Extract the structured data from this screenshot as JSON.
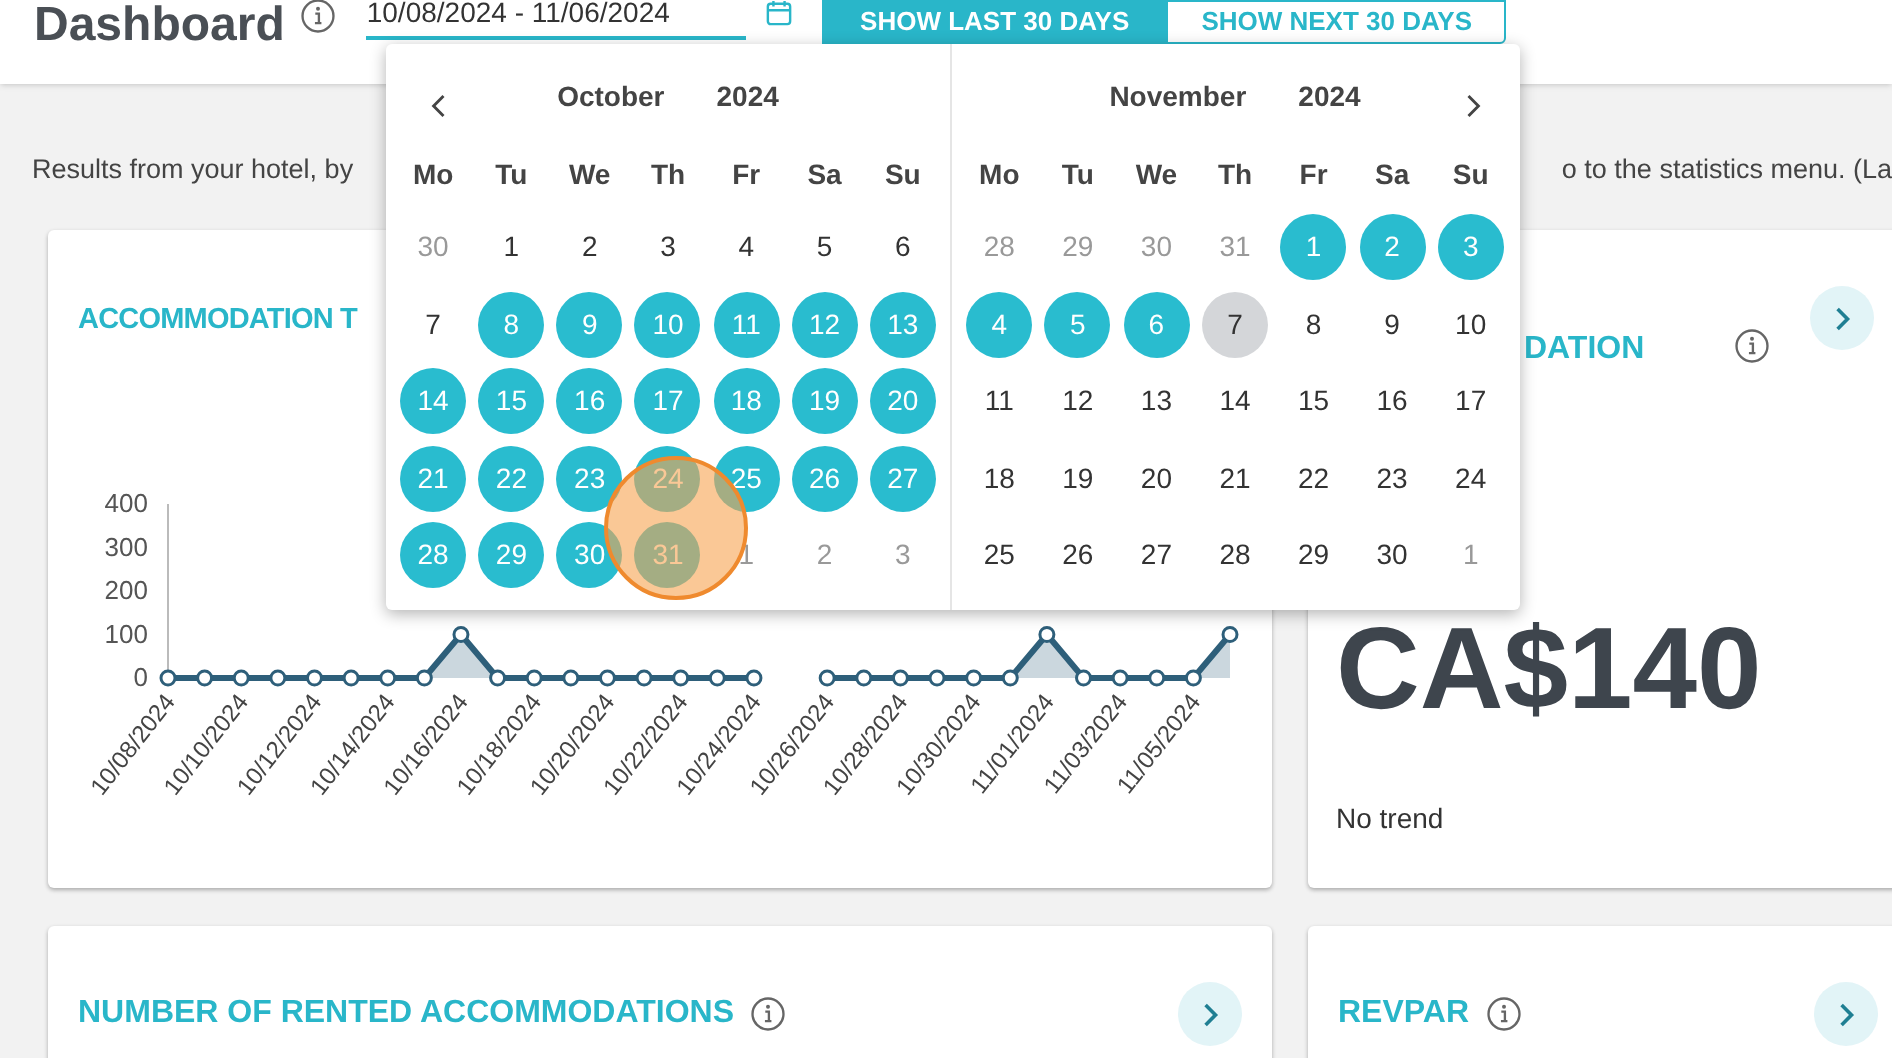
{
  "header": {
    "title": "Dashboard",
    "date_range": {
      "value": "10/08/2024 - 11/06/2024"
    },
    "buttons": [
      {
        "label": "SHOW LAST 30 DAYS",
        "selected": true
      },
      {
        "label": "SHOW NEXT 30 DAYS",
        "selected": false
      }
    ]
  },
  "intro": {
    "left": "Results from your hotel, by",
    "right": "o to the statistics menu. (La"
  },
  "cards": [
    {
      "kind": "chart",
      "title": "ACCOMMODATION T",
      "chart_data": {
        "type": "area",
        "categories": [
          "10/08/2024",
          null,
          "10/10/2024",
          null,
          "10/12/2024",
          null,
          "10/14/2024",
          null,
          "10/16/2024",
          null,
          "10/18/2024",
          null,
          "10/20/2024",
          null,
          "10/22/2024",
          null,
          "10/24/2024",
          null,
          "10/26/2024",
          null,
          "10/28/2024",
          null,
          "10/30/2024",
          null,
          "11/01/2024",
          null,
          "11/03/2024",
          null,
          "11/05/2024",
          null
        ],
        "series": [
          {
            "color": "#2e5f7a",
            "values": [
              0,
              0,
              0,
              0,
              0,
              0,
              0,
              0,
              100,
              0,
              0,
              0,
              0,
              0,
              0,
              0,
              0,
              null,
              0,
              0,
              0,
              0,
              0,
              0,
              100,
              0,
              0,
              0,
              0,
              100
            ]
          }
        ],
        "ylim": [
          0,
          400
        ],
        "yticks": [
          0,
          100,
          200,
          300,
          400
        ]
      }
    },
    {
      "kind": "value",
      "title": "DATION",
      "value": "CA$140",
      "trend": "No trend"
    },
    {
      "kind": "header",
      "title": "NUMBER OF RENTED ACCOMMODATIONS"
    },
    {
      "kind": "header",
      "title": "REVPAR"
    }
  ],
  "calendar": {
    "months": [
      {
        "month": "October",
        "year": "2024",
        "weekdays": [
          "Mo",
          "Tu",
          "We",
          "Th",
          "Fr",
          "Sa",
          "Su"
        ],
        "weeks": [
          [
            {
              "day": "30",
              "outside": true,
              "selected": false,
              "today": false
            },
            {
              "day": "1",
              "outside": false,
              "selected": false,
              "today": false
            },
            {
              "day": "2",
              "outside": false,
              "selected": false,
              "today": false
            },
            {
              "day": "3",
              "outside": false,
              "selected": false,
              "today": false
            },
            {
              "day": "4",
              "outside": false,
              "selected": false,
              "today": false
            },
            {
              "day": "5",
              "outside": false,
              "selected": false,
              "today": false
            },
            {
              "day": "6",
              "outside": false,
              "selected": false,
              "today": false
            }
          ],
          [
            {
              "day": "7",
              "outside": false,
              "selected": false,
              "today": false
            },
            {
              "day": "8",
              "outside": false,
              "selected": true,
              "today": false
            },
            {
              "day": "9",
              "outside": false,
              "selected": true,
              "today": false
            },
            {
              "day": "10",
              "outside": false,
              "selected": true,
              "today": false
            },
            {
              "day": "11",
              "outside": false,
              "selected": true,
              "today": false
            },
            {
              "day": "12",
              "outside": false,
              "selected": true,
              "today": false
            },
            {
              "day": "13",
              "outside": false,
              "selected": true,
              "today": false
            }
          ],
          [
            {
              "day": "14",
              "outside": false,
              "selected": true,
              "today": false
            },
            {
              "day": "15",
              "outside": false,
              "selected": true,
              "today": false
            },
            {
              "day": "16",
              "outside": false,
              "selected": true,
              "today": false
            },
            {
              "day": "17",
              "outside": false,
              "selected": true,
              "today": false
            },
            {
              "day": "18",
              "outside": false,
              "selected": true,
              "today": false
            },
            {
              "day": "19",
              "outside": false,
              "selected": true,
              "today": false
            },
            {
              "day": "20",
              "outside": false,
              "selected": true,
              "today": false
            }
          ],
          [
            {
              "day": "21",
              "outside": false,
              "selected": true,
              "today": false
            },
            {
              "day": "22",
              "outside": false,
              "selected": true,
              "today": false
            },
            {
              "day": "23",
              "outside": false,
              "selected": true,
              "today": false
            },
            {
              "day": "24",
              "outside": false,
              "selected": true,
              "today": false
            },
            {
              "day": "25",
              "outside": false,
              "selected": true,
              "today": false
            },
            {
              "day": "26",
              "outside": false,
              "selected": true,
              "today": false
            },
            {
              "day": "27",
              "outside": false,
              "selected": true,
              "today": false
            }
          ],
          [
            {
              "day": "28",
              "outside": false,
              "selected": true,
              "today": false
            },
            {
              "day": "29",
              "outside": false,
              "selected": true,
              "today": false
            },
            {
              "day": "30",
              "outside": false,
              "selected": true,
              "today": false
            },
            {
              "day": "31",
              "outside": false,
              "selected": true,
              "today": false
            },
            {
              "day": "1",
              "outside": true,
              "selected": false,
              "today": false
            },
            {
              "day": "2",
              "outside": true,
              "selected": false,
              "today": false
            },
            {
              "day": "3",
              "outside": true,
              "selected": false,
              "today": false
            }
          ]
        ]
      },
      {
        "month": "November",
        "year": "2024",
        "weekdays": [
          "Mo",
          "Tu",
          "We",
          "Th",
          "Fr",
          "Sa",
          "Su"
        ],
        "weeks": [
          [
            {
              "day": "28",
              "outside": true,
              "selected": false,
              "today": false
            },
            {
              "day": "29",
              "outside": true,
              "selected": false,
              "today": false
            },
            {
              "day": "30",
              "outside": true,
              "selected": false,
              "today": false
            },
            {
              "day": "31",
              "outside": true,
              "selected": false,
              "today": false
            },
            {
              "day": "1",
              "outside": false,
              "selected": true,
              "today": false
            },
            {
              "day": "2",
              "outside": false,
              "selected": true,
              "today": false
            },
            {
              "day": "3",
              "outside": false,
              "selected": true,
              "today": false
            }
          ],
          [
            {
              "day": "4",
              "outside": false,
              "selected": true,
              "today": false
            },
            {
              "day": "5",
              "outside": false,
              "selected": true,
              "today": false
            },
            {
              "day": "6",
              "outside": false,
              "selected": true,
              "today": false
            },
            {
              "day": "7",
              "outside": false,
              "selected": false,
              "today": true
            },
            {
              "day": "8",
              "outside": false,
              "selected": false,
              "today": false
            },
            {
              "day": "9",
              "outside": false,
              "selected": false,
              "today": false
            },
            {
              "day": "10",
              "outside": false,
              "selected": false,
              "today": false
            }
          ],
          [
            {
              "day": "11",
              "outside": false,
              "selected": false,
              "today": false
            },
            {
              "day": "12",
              "outside": false,
              "selected": false,
              "today": false
            },
            {
              "day": "13",
              "outside": false,
              "selected": false,
              "today": false
            },
            {
              "day": "14",
              "outside": false,
              "selected": false,
              "today": false
            },
            {
              "day": "15",
              "outside": false,
              "selected": false,
              "today": false
            },
            {
              "day": "16",
              "outside": false,
              "selected": false,
              "today": false
            },
            {
              "day": "17",
              "outside": false,
              "selected": false,
              "today": false
            }
          ],
          [
            {
              "day": "18",
              "outside": false,
              "selected": false,
              "today": false
            },
            {
              "day": "19",
              "outside": false,
              "selected": false,
              "today": false
            },
            {
              "day": "20",
              "outside": false,
              "selected": false,
              "today": false
            },
            {
              "day": "21",
              "outside": false,
              "selected": false,
              "today": false
            },
            {
              "day": "22",
              "outside": false,
              "selected": false,
              "today": false
            },
            {
              "day": "23",
              "outside": false,
              "selected": false,
              "today": false
            },
            {
              "day": "24",
              "outside": false,
              "selected": false,
              "today": false
            }
          ],
          [
            {
              "day": "25",
              "outside": false,
              "selected": false,
              "today": false
            },
            {
              "day": "26",
              "outside": false,
              "selected": false,
              "today": false
            },
            {
              "day": "27",
              "outside": false,
              "selected": false,
              "today": false
            },
            {
              "day": "28",
              "outside": false,
              "selected": false,
              "today": false
            },
            {
              "day": "29",
              "outside": false,
              "selected": false,
              "today": false
            },
            {
              "day": "30",
              "outside": false,
              "selected": false,
              "today": false
            },
            {
              "day": "1",
              "outside": true,
              "selected": false,
              "today": false
            }
          ]
        ]
      }
    ]
  }
}
